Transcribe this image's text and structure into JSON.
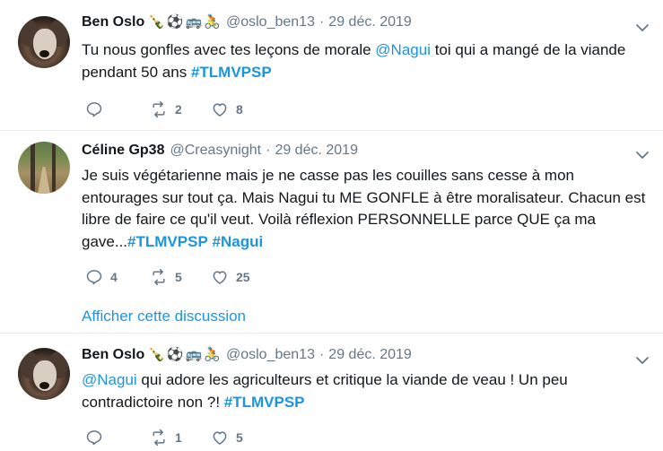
{
  "tweets": [
    {
      "author": "Ben Oslo",
      "emoji": [
        "🍾",
        "⚽",
        "🚌",
        "🚴"
      ],
      "handle": "@oslo_ben13",
      "dot": "·",
      "date": "29 déc. 2019",
      "text_parts": [
        "Tu nous gonfles avec tes leçons de morale ",
        "@Nagui",
        " toi qui a mangé de la viande pendant 50 ans ",
        "#TLMVPSP"
      ],
      "reply_count": "",
      "retweet_count": "2",
      "like_count": "8"
    },
    {
      "author": "Céline Gp38",
      "handle": "@Creasynight",
      "dot": "·",
      "date": "29 déc. 2019",
      "text_parts": [
        "Je suis végétarienne mais je ne casse pas les couilles sans cesse à  mon entourages sur tout ça.  Mais Nagui tu ME GONFLE  à  être moralisateur. Chacun est libre de faire ce qu'il  veut. Voilà  réflexion PERSONNELLE parce QUE  ça ma gave...",
        "#TLMVPSP",
        " ",
        "#Nagui"
      ],
      "reply_count": "4",
      "retweet_count": "5",
      "like_count": "25",
      "thread_link": "Afficher cette discussion"
    },
    {
      "author": "Ben Oslo",
      "emoji": [
        "🍾",
        "⚽",
        "🚌",
        "🚴"
      ],
      "handle": "@oslo_ben13",
      "dot": "·",
      "date": "29 déc. 2019",
      "text_parts": [
        "@Nagui",
        " qui adore les agriculteurs et critique la viande de veau ! Un peu contradictoire non ?! ",
        "#TLMVPSP"
      ],
      "reply_count": "",
      "retweet_count": "1",
      "like_count": "5"
    }
  ],
  "icons": {
    "reply": "reply-icon",
    "retweet": "retweet-icon",
    "like": "heart-icon",
    "caret": "chevron-down-icon"
  },
  "colors": {
    "link": "#1b95e0",
    "muted": "#657786",
    "text": "#14171a",
    "divider": "#e6ecf0"
  }
}
